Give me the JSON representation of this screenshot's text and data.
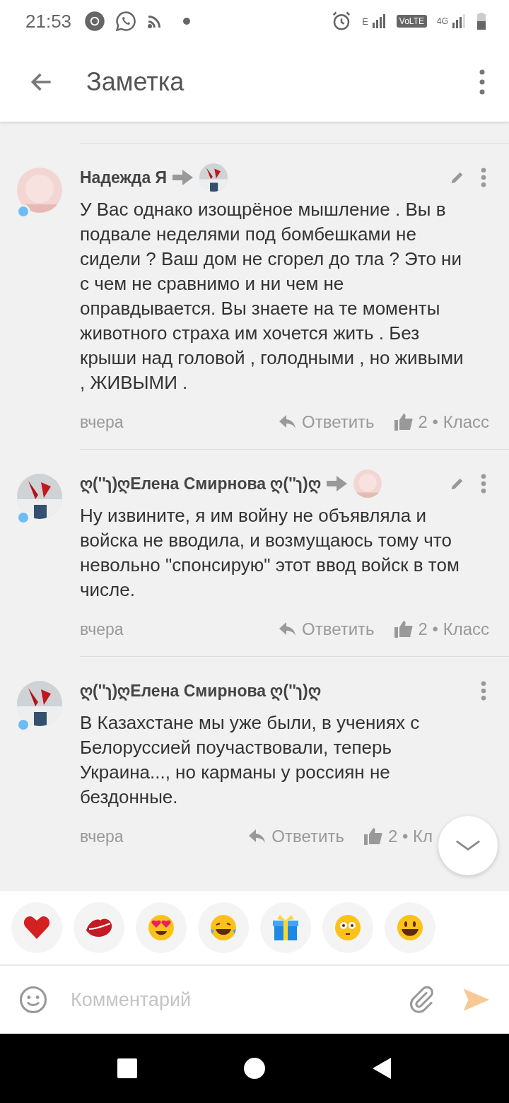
{
  "status_bar": {
    "time": "21:53",
    "network_label": "E",
    "volte": "VoLTE",
    "data_label": "4G"
  },
  "app_bar": {
    "title": "Заметка"
  },
  "comments": [
    {
      "author": "Надежда Я",
      "online": true,
      "reply_target": true,
      "editable": true,
      "text": "У Вас однако изощрёное мышление . Вы в подвале неделями под бомбешками не сидели ? Ваш дом не сгорел до тла ? Это ни с чем не сравнимо  и ни чем не оправдывается. Вы знаете на те моменты животного страха им хочется жить . Без крыши над головой , голодными , но живыми , ЖИВЫМИ .",
      "time": "вчера",
      "reply": "Ответить",
      "likes": "2 • Класс"
    },
    {
      "author": "ღ(''ɿ)ღЕлена Смирнова ღ(''ɿ)ღ",
      "online": true,
      "reply_target": true,
      "editable": true,
      "text": "Ну извините, я им войну не объявляла и войска не вводила, и возмущаюсь тому что невольно \"спонсирую\" этот ввод войск в том числе.",
      "time": "вчера",
      "reply": "Ответить",
      "likes": "2 • Класс"
    },
    {
      "author": "ღ(''ɿ)ღЕлена Смирнова ღ(''ɿ)ღ",
      "online": true,
      "reply_target": false,
      "editable": false,
      "text": "В Казахстане мы уже были, в  учениях с Белоруссией поучаствовали, теперь Украина..., но карманы у россиян не бездонные.",
      "time": "вчера",
      "reply": "Ответить",
      "likes": "2 • Кл"
    }
  ],
  "reactions": [
    {
      "kind": "heart"
    },
    {
      "kind": "kiss"
    },
    {
      "kind": "heart-eyes"
    },
    {
      "kind": "laugh"
    },
    {
      "kind": "gift"
    },
    {
      "kind": "flushed"
    },
    {
      "kind": "grin"
    }
  ],
  "composer": {
    "placeholder": "Комментарий"
  }
}
